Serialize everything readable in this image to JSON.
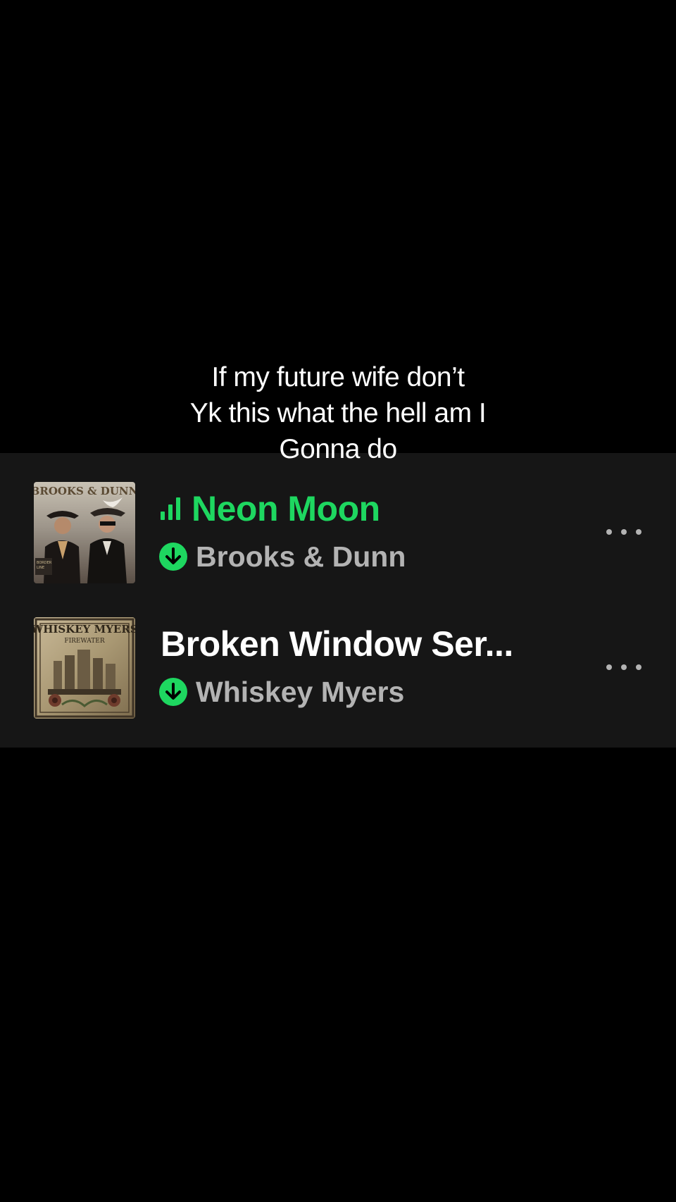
{
  "caption": {
    "lines": [
      "If my future wife don’t",
      "Yk this what the hell am I",
      "Gonna do"
    ]
  },
  "tracks": [
    {
      "title": "Neon Moon",
      "artist": "Brooks & Dunn",
      "now_playing": true,
      "downloaded": true,
      "album_art_text": "BROOKS & DUNN"
    },
    {
      "title": "Broken Window Ser...",
      "artist": "Whiskey Myers",
      "now_playing": false,
      "downloaded": true,
      "album_art_text": "WHISKEY MYERS",
      "album_art_subtext": "FIREWATER"
    }
  ],
  "icons": {
    "now_playing": "equalizer-bars-icon",
    "download": "download-arrow-icon",
    "more": "more-options-icon"
  },
  "colors": {
    "background": "#000000",
    "panel": "#161616",
    "accent": "#1ed760",
    "primary_text": "#ffffff",
    "secondary_text": "#b3b3b3"
  }
}
